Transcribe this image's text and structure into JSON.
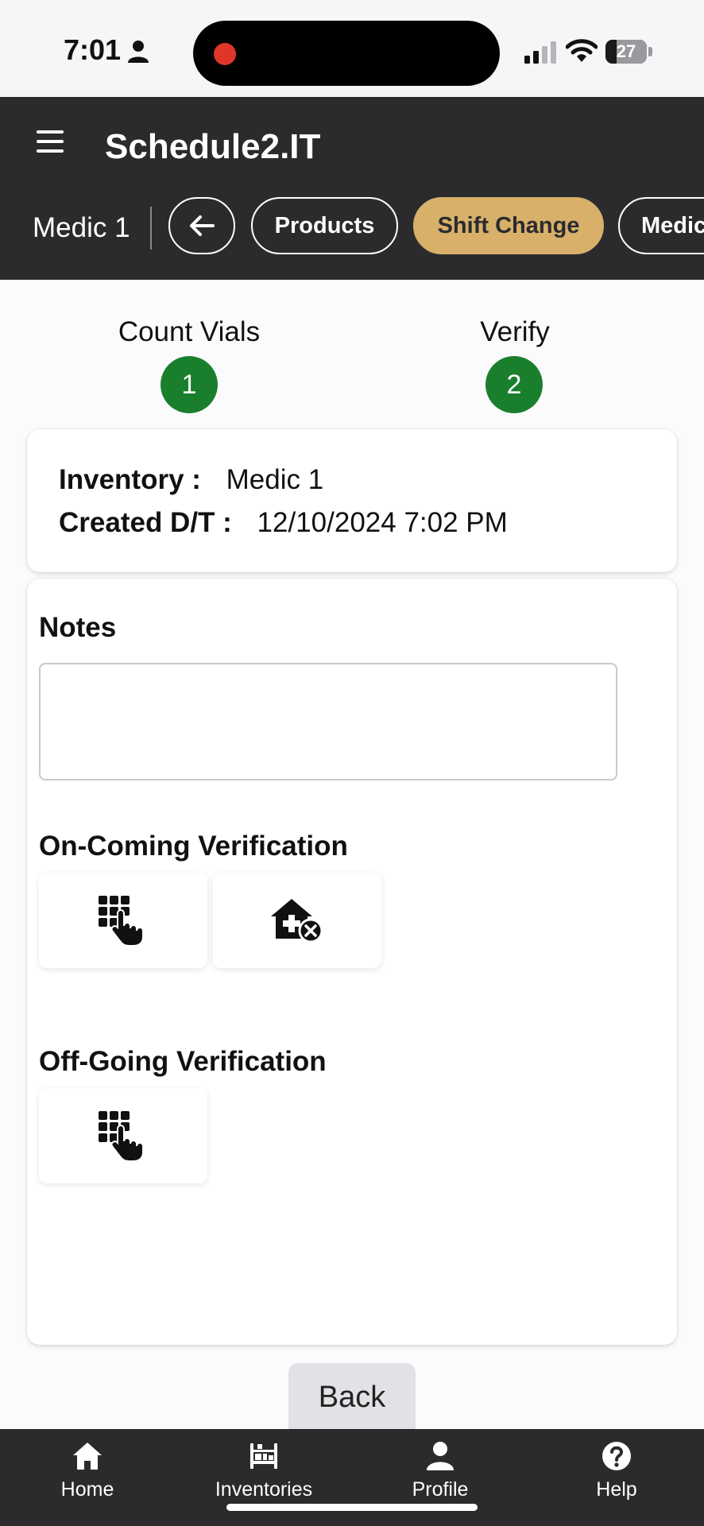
{
  "status_bar": {
    "time": "7:01",
    "battery": "27",
    "battery_level": 0.27
  },
  "header": {
    "title": "Schedule2.IT",
    "inventory": "Medic 1",
    "chips": {
      "products": "Products",
      "shift_change": "Shift Change",
      "medic": "Medic"
    }
  },
  "stepper": {
    "steps": [
      {
        "label": "Count Vials",
        "number": "1"
      },
      {
        "label": "Verify",
        "number": "2"
      }
    ]
  },
  "info": {
    "inventory_label": "Inventory :",
    "inventory_value": "Medic 1",
    "created_label": "Created D/T :",
    "created_value": "12/10/2024 7:02 PM"
  },
  "notes": {
    "title": "Notes",
    "value": ""
  },
  "oncoming": {
    "title": "On-Coming Verification"
  },
  "offgoing": {
    "title": "Off-Going Verification"
  },
  "back_button": "Back",
  "tabs": [
    {
      "label": "Home",
      "icon": "home-icon"
    },
    {
      "label": "Inventories",
      "icon": "inventories-icon"
    },
    {
      "label": "Profile",
      "icon": "profile-icon"
    },
    {
      "label": "Help",
      "icon": "help-icon"
    }
  ],
  "colors": {
    "header_bg": "#2b2b2e",
    "active_chip": "#d8b06a",
    "step_green": "#1a7f2d"
  }
}
